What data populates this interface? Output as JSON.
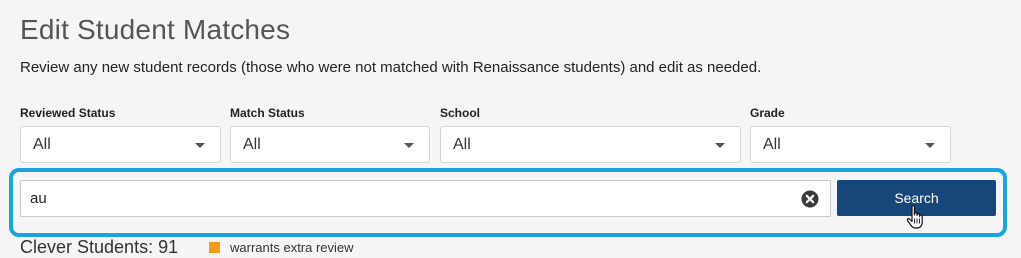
{
  "page": {
    "title": "Edit Student Matches",
    "subtitle": "Review any new student records (those who were not matched with Renaissance students) and edit as needed."
  },
  "filters": [
    {
      "label": "Reviewed Status",
      "value": "All"
    },
    {
      "label": "Match Status",
      "value": "All"
    },
    {
      "label": "School",
      "value": "All"
    },
    {
      "label": "Grade",
      "value": "All"
    }
  ],
  "search": {
    "value": "au",
    "button_label": "Search",
    "clear_icon": "clear-icon"
  },
  "results": {
    "heading_partial": "Clever Students: 91",
    "legend_text": "warrants extra review",
    "legend_color": "#f39a1e"
  },
  "colors": {
    "highlight": "#1aa3dd",
    "button": "#17467a"
  }
}
